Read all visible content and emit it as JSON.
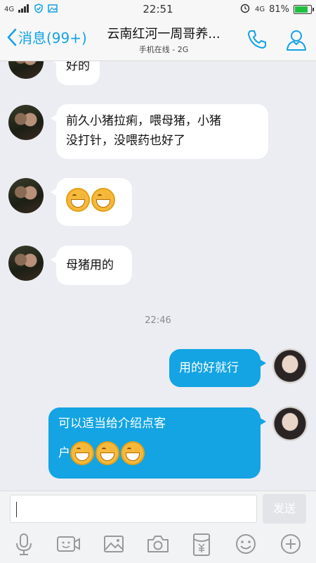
{
  "statusbar": {
    "network_left": "4G",
    "time": "22:51",
    "network_right": "4G",
    "battery": "81%",
    "battery_level": 0.81
  },
  "header": {
    "back_label": "消息(99+)",
    "title": "云南红河一周哥养...",
    "subtitle": "手机在线 - 2G",
    "icons": [
      "phone-icon",
      "profile-icon"
    ]
  },
  "messages": [
    {
      "side": "in",
      "text": "好的"
    },
    {
      "side": "in",
      "text_line1": "前久小猪拉痢，喂母猪，小猪",
      "text_line2": "没打针，没喂药也好了"
    },
    {
      "side": "in",
      "emoji": [
        "grin",
        "grin"
      ]
    },
    {
      "side": "in",
      "text": "母猪用的"
    },
    {
      "side": "out",
      "text": "用的好就行"
    },
    {
      "side": "out",
      "text_line1": "可以适当给介绍点客",
      "text_line2": "户",
      "emoji": [
        "grin",
        "grin",
        "grin"
      ]
    }
  ],
  "timestamp": "22:46",
  "input": {
    "value": "",
    "send_label": "发送"
  },
  "toolbar": {
    "icons": [
      "microphone-icon",
      "video-icon",
      "image-icon",
      "camera-icon",
      "red-packet-icon",
      "emoji-icon",
      "plus-icon"
    ]
  },
  "colors": {
    "accent": "#14a4e3",
    "background": "#ebedf2"
  }
}
